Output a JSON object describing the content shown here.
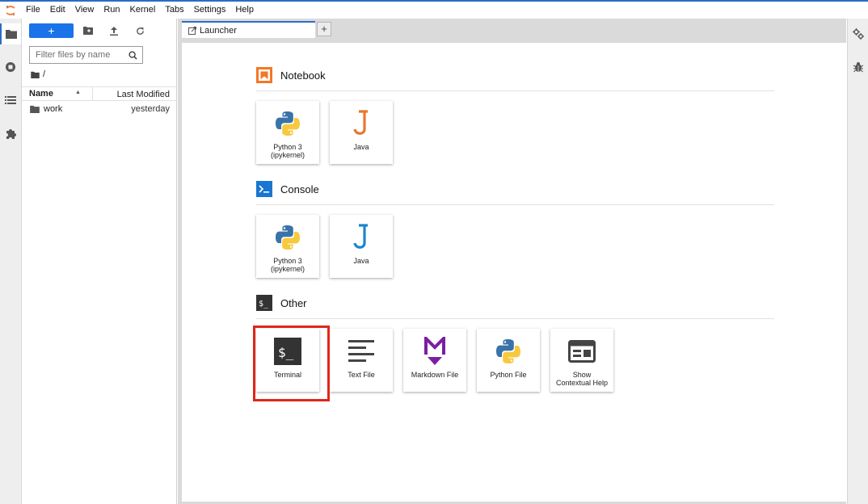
{
  "menubar": {
    "items": [
      "File",
      "Edit",
      "View",
      "Run",
      "Kernel",
      "Tabs",
      "Settings",
      "Help"
    ]
  },
  "filebrowser": {
    "new_label": "+",
    "filter_placeholder": "Filter files by name",
    "breadcrumb": "/",
    "col_name": "Name",
    "col_modified": "Last Modified",
    "rows": [
      {
        "name": "work",
        "modified": "yesterday"
      }
    ]
  },
  "tabs": {
    "launcher_label": "Launcher",
    "add_label": "+"
  },
  "launcher": {
    "sections": [
      {
        "title": "Notebook",
        "cards": [
          {
            "label": "Python 3\n(ipykernel)",
            "icon": "python-logo-icon"
          },
          {
            "label": "Java",
            "icon": "java-j-icon"
          }
        ]
      },
      {
        "title": "Console",
        "cards": [
          {
            "label": "Python 3\n(ipykernel)",
            "icon": "python-logo-icon"
          },
          {
            "label": "Java",
            "icon": "java-j-icon"
          }
        ]
      },
      {
        "title": "Other",
        "cards": [
          {
            "label": "Terminal",
            "icon": "terminal-icon"
          },
          {
            "label": "Text File",
            "icon": "text-file-icon"
          },
          {
            "label": "Markdown File",
            "icon": "markdown-icon"
          },
          {
            "label": "Python File",
            "icon": "python-logo-icon"
          },
          {
            "label": "Show\nContextual Help",
            "icon": "contextual-help-icon"
          }
        ]
      }
    ]
  },
  "colors": {
    "accent": "#2b6cc4",
    "new_button": "#1a73e8",
    "notebook_icon": "#f37726",
    "console_icon": "#1976d2",
    "java_orange": "#e8772e",
    "java_blue": "#1a86d0",
    "markdown_purple": "#7b1fa2",
    "highlight": "#e0271a"
  }
}
